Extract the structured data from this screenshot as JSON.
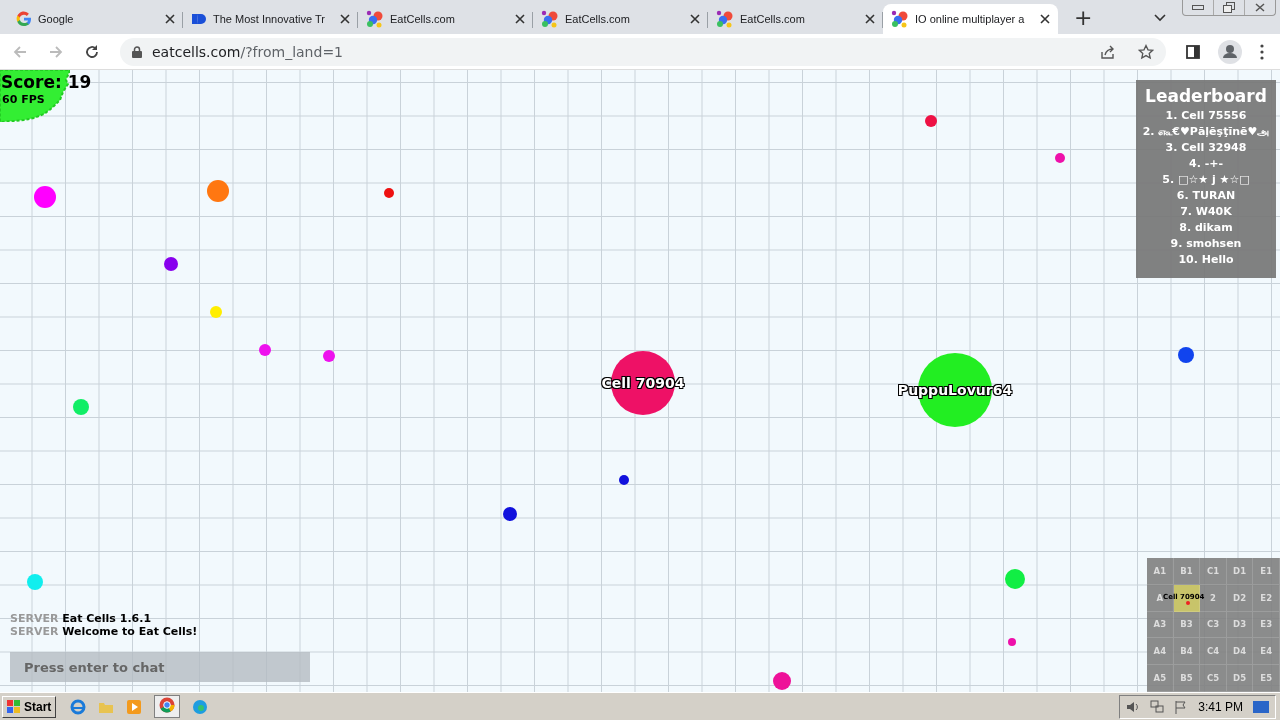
{
  "browser": {
    "tabs": [
      {
        "title": "Google",
        "kind": "google",
        "selected": false
      },
      {
        "title": "The Most Innovative Tr",
        "kind": "flag",
        "selected": false
      },
      {
        "title": "EatCells.com",
        "kind": "cells",
        "selected": false
      },
      {
        "title": "EatCells.com",
        "kind": "cells",
        "selected": false
      },
      {
        "title": "EatCells.com",
        "kind": "cells",
        "selected": false
      },
      {
        "title": "IO online multiplayer a",
        "kind": "cells",
        "selected": true
      }
    ],
    "new_tab": "+",
    "address": {
      "domain": "eatcells.com",
      "path": "/?from_land=1"
    }
  },
  "game": {
    "score": "Score: 19",
    "fps": "60 FPS",
    "leaderboard": {
      "title": "Leaderboard",
      "entries": [
        "1. Cell 75556",
        "2. ௷€♥Pāļēşţīnē♥அ",
        "3. Cell 32948",
        "4. -+-",
        "5. □☆★ j ★☆□",
        "6. TURAN",
        "7. W40K",
        "8. dikam",
        "9. smohsen",
        "10. Hello"
      ]
    },
    "players": [
      {
        "name": "Cell 70904",
        "color": "#ee1166"
      },
      {
        "name": "PuppuLovur64",
        "color": "#22ee22"
      }
    ],
    "food": [
      {
        "color": "#ff00ff"
      },
      {
        "color": "#ff7711"
      },
      {
        "color": "#ee1111"
      },
      {
        "color": "#8800ee"
      },
      {
        "color": "#ffee00"
      },
      {
        "color": "#ee11ee"
      },
      {
        "color": "#ee11ee"
      },
      {
        "color": "#11ee66"
      },
      {
        "color": "#11eeee"
      },
      {
        "color": "#1111dd"
      },
      {
        "color": "#1111dd"
      },
      {
        "color": "#ee1144"
      },
      {
        "color": "#ee11aa"
      },
      {
        "color": "#1144ee"
      },
      {
        "color": "#11ee44"
      },
      {
        "color": "#ee11aa"
      },
      {
        "color": "#ee1199"
      }
    ],
    "chat": {
      "messages": [
        {
          "sender": "SERVER",
          "text": "Eat Cells 1.6.1"
        },
        {
          "sender": "SERVER",
          "text": "Welcome to Eat Cells!"
        }
      ],
      "placeholder": "Press enter to chat"
    },
    "minimap": {
      "player_label": "Cell 70904",
      "cells": [
        {
          "label": "A1"
        },
        {
          "label": "B1"
        },
        {
          "label": "C1"
        },
        {
          "label": "D1"
        },
        {
          "label": "E1"
        },
        {
          "label": "A"
        },
        {
          "current": true
        },
        {
          "label": "2"
        },
        {
          "label": "D2"
        },
        {
          "label": "E2"
        },
        {
          "label": "A3"
        },
        {
          "label": "B3"
        },
        {
          "label": "C3"
        },
        {
          "label": "D3"
        },
        {
          "label": "E3"
        },
        {
          "label": "A4"
        },
        {
          "label": "B4"
        },
        {
          "label": "C4"
        },
        {
          "label": "D4"
        },
        {
          "label": "E4"
        },
        {
          "label": "A5"
        },
        {
          "label": "B5"
        },
        {
          "label": "C5"
        },
        {
          "label": "D5"
        },
        {
          "label": "E5"
        }
      ]
    }
  },
  "taskbar": {
    "start": "Start",
    "clock": "3:41 PM"
  }
}
